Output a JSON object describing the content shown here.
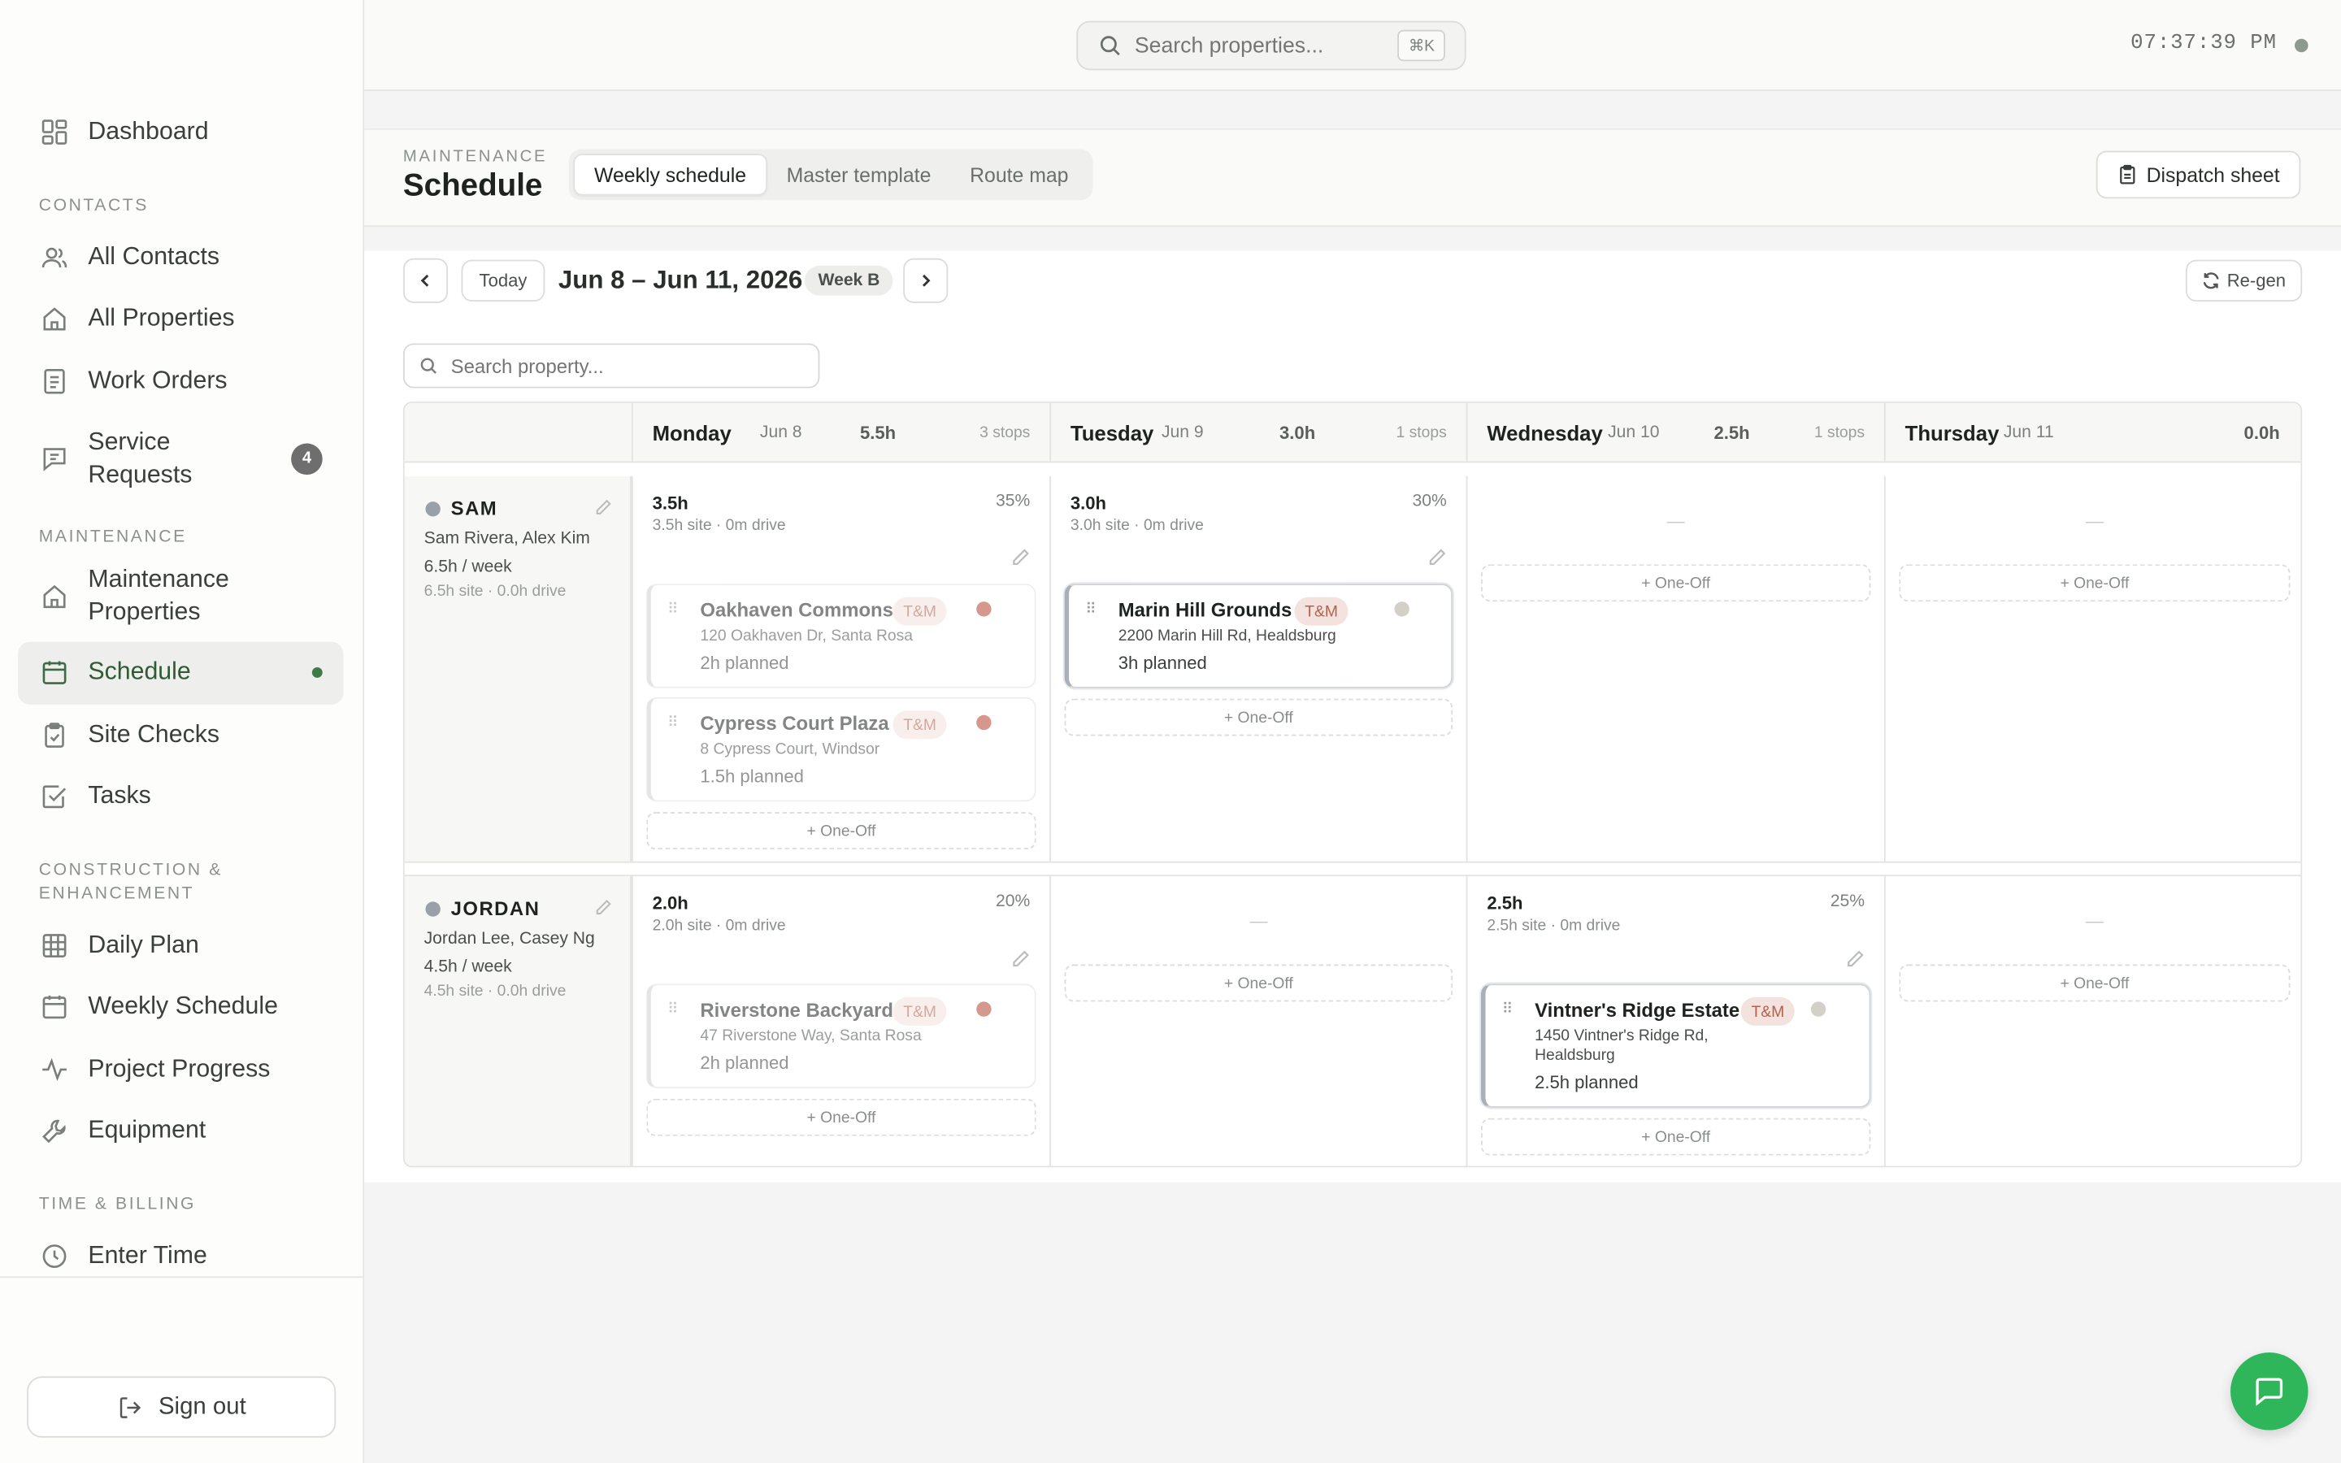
{
  "sidebar": {
    "items_top": [
      {
        "label": "Dashboard",
        "icon": "dashboard-icon"
      }
    ],
    "sections": [
      {
        "title": "CONTACTS",
        "items": [
          {
            "label": "All Contacts",
            "icon": "contacts-icon"
          },
          {
            "label": "All Properties",
            "icon": "home-icon"
          },
          {
            "label": "Work Orders",
            "icon": "document-icon"
          },
          {
            "label": "Service Requests",
            "icon": "message-icon",
            "badge": "4"
          }
        ]
      },
      {
        "title": "MAINTENANCE",
        "items": [
          {
            "label": "Maintenance Properties",
            "icon": "home-icon"
          },
          {
            "label": "Schedule",
            "icon": "calendar-icon",
            "active": true
          },
          {
            "label": "Site Checks",
            "icon": "clipboard-icon"
          },
          {
            "label": "Tasks",
            "icon": "checkbox-icon"
          }
        ]
      },
      {
        "title": "CONSTRUCTION & ENHANCEMENT",
        "items": [
          {
            "label": "Daily Plan",
            "icon": "grid-icon"
          },
          {
            "label": "Weekly Schedule",
            "icon": "calendar-icon"
          },
          {
            "label": "Project Progress",
            "icon": "activity-icon"
          },
          {
            "label": "Equipment",
            "icon": "wrench-icon"
          }
        ]
      },
      {
        "title": "TIME & BILLING",
        "items": [
          {
            "label": "Enter Time",
            "icon": "clock-icon"
          }
        ]
      }
    ],
    "signout": "Sign out"
  },
  "topbar": {
    "search_placeholder": "Search properties...",
    "shortcut": "⌘K",
    "clock": "07:37:39 PM"
  },
  "header": {
    "eyebrow": "MAINTENANCE",
    "title": "Schedule",
    "tabs": [
      "Weekly schedule",
      "Master template",
      "Route map"
    ],
    "active_tab": "Weekly schedule",
    "dispatch": "Dispatch sheet"
  },
  "toolbar": {
    "today": "Today",
    "range": "Jun 8 – Jun 11, 2026",
    "week": "Week B",
    "regen": "Re-gen",
    "search_placeholder": "Search property..."
  },
  "days": [
    {
      "day": "Monday",
      "date": "Jun 8",
      "hours": "5.5h",
      "stops": "3 stops"
    },
    {
      "day": "Tuesday",
      "date": "Jun 9",
      "hours": "3.0h",
      "stops": "1 stops"
    },
    {
      "day": "Wednesday",
      "date": "Jun 10",
      "hours": "2.5h",
      "stops": "1 stops"
    },
    {
      "day": "Thursday",
      "date": "Jun 11",
      "hours": "0.0h",
      "stops": ""
    }
  ],
  "one_off": "+ One-Off",
  "empty": "—",
  "techs": [
    {
      "name": "SAM",
      "crew": "Sam Rivera, Alex Kim",
      "week": "6.5h / week",
      "sub": "6.5h site · 0.0h drive",
      "cells": [
        {
          "hours": "3.5h",
          "pct": "35%",
          "sub": "3.5h site · 0m drive",
          "cards": [
            {
              "name": "Oakhaven Commons",
              "tag": "T&M",
              "addr": "120 Oakhaven Dr, Santa Rosa",
              "planned": "2h planned",
              "dot": "#b5442f",
              "faded": true
            },
            {
              "name": "Cypress Court Plaza",
              "tag": "T&M",
              "addr": "8 Cypress Court, Windsor",
              "planned": "1.5h planned",
              "dot": "#b5442f",
              "faded": true
            }
          ]
        },
        {
          "hours": "3.0h",
          "pct": "30%",
          "sub": "3.0h site · 0m drive",
          "cards": [
            {
              "name": "Marin Hill Grounds",
              "tag": "T&M",
              "addr": "2200 Marin Hill Rd, Healdsburg",
              "planned": "3h planned",
              "dot": "#d3d0c8",
              "faded": false
            }
          ]
        },
        {
          "empty": true
        },
        {
          "empty": true
        }
      ]
    },
    {
      "name": "JORDAN",
      "crew": "Jordan Lee, Casey Ng",
      "week": "4.5h / week",
      "sub": "4.5h site · 0.0h drive",
      "cells": [
        {
          "hours": "2.0h",
          "pct": "20%",
          "sub": "2.0h site · 0m drive",
          "cards": [
            {
              "name": "Riverstone Backyard",
              "tag": "T&M",
              "addr": "47 Riverstone Way, Santa Rosa",
              "planned": "2h planned",
              "dot": "#b5442f",
              "faded": true
            }
          ]
        },
        {
          "empty": true
        },
        {
          "hours": "2.5h",
          "pct": "25%",
          "sub": "2.5h site · 0m drive",
          "cards": [
            {
              "name": "Vintner's Ridge Estate",
              "tag": "T&M",
              "addr": "1450 Vintner's Ridge Rd, Healdsburg",
              "planned": "2.5h planned",
              "dot": "#d3d0c8",
              "faded": false
            }
          ]
        },
        {
          "empty": true
        }
      ]
    }
  ],
  "colors": {
    "accent": "#3f6b44",
    "chat": "#2fb55a",
    "tag_bg": "#f3e2dd",
    "tag_text": "#b2614c"
  }
}
